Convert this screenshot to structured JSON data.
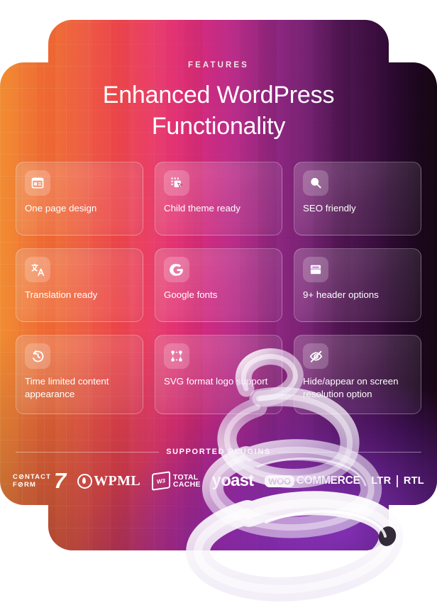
{
  "hero": {
    "eyebrow": "FEATURES",
    "headline_line1": "Enhanced WordPress",
    "headline_line2": "Functionality"
  },
  "features": [
    {
      "icon": "one-page-layout-icon",
      "label": "One page design"
    },
    {
      "icon": "select-object-icon",
      "label": "Child theme ready"
    },
    {
      "icon": "magnifier-icon",
      "label": "SEO friendly"
    },
    {
      "icon": "translate-icon",
      "label": "Translation ready"
    },
    {
      "icon": "google-g-icon",
      "label": "Google fonts"
    },
    {
      "icon": "header-bar-icon",
      "label": "9+ header options"
    },
    {
      "icon": "clock-history-icon",
      "label": "Time limited content appearance"
    },
    {
      "icon": "vector-nodes-icon",
      "label": "SVG format logo support"
    },
    {
      "icon": "eye-off-icon",
      "label": "Hide/appear on screen resolution option"
    }
  ],
  "supported": {
    "label": "SUPPORTED PLUGINS",
    "logos": [
      {
        "name": "contact-form-7-logo",
        "line1": "C⊘NTACT",
        "line2": "F⊘RM",
        "mark": "7"
      },
      {
        "name": "wpml-logo",
        "text": "WPML"
      },
      {
        "name": "w3-total-cache-logo",
        "mark": "W3",
        "line1": "TOTAL",
        "line2": "CACHE"
      },
      {
        "name": "yoast-logo",
        "text": "yoast"
      },
      {
        "name": "woocommerce-logo",
        "badge": "WOO",
        "text": "COMMERCE"
      },
      {
        "name": "ltr-rtl-logo",
        "left": "LTR",
        "right": "RTL"
      }
    ]
  },
  "colors": {
    "gradient_start": "#f2862f",
    "gradient_mid_red": "#ea3f5f",
    "gradient_mid_magenta": "#cf2a7f",
    "gradient_purple": "#8e2580",
    "gradient_end": "#14040f",
    "card_text": "#ffffff",
    "glow_purple": "#963ad6"
  }
}
